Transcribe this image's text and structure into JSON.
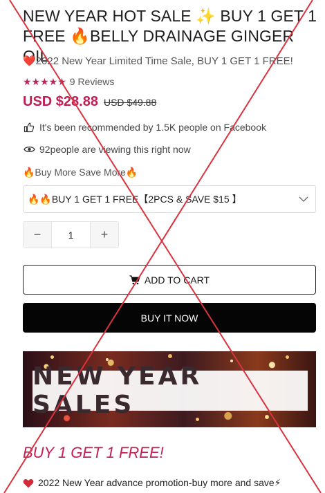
{
  "product": {
    "title": "NEW YEAR HOT SALE ✨ BUY 1 GET 1 FREE 🔥BELLY DRAINAGE GINGER OIL",
    "subtitle": "❤️2022 New Year Limited Time Sale, BUY 1 GET 1 FREE!",
    "stars": "★★★★★",
    "reviews": "9 Reviews",
    "price": "USD $28.88",
    "compare_price": "USD $49.88"
  },
  "social_proof": {
    "recommended": "It's been recommended by 1.5K people on Facebook",
    "viewing": "92people are viewing this right now"
  },
  "buy_more": "🔥Buy More Save More🔥",
  "variant": {
    "selected": "🔥🔥BUY 1 GET 1 FREE【2PCS & SAVE $15 】"
  },
  "quantity": {
    "minus": "−",
    "value": "1",
    "plus": "+"
  },
  "actions": {
    "add_to_cart": "ADD TO CART",
    "buy_now": "BUY IT NOW"
  },
  "banner": {
    "text": "NEW YEAR SALES"
  },
  "promo": {
    "heading": "BUY 1 GET 1 FREE!",
    "line": "2022 New Year advance promotion-buy more and save⚡"
  },
  "colors": {
    "accent": "#c11e54",
    "star": "#b8265d",
    "cross": "#d9333f",
    "button_dark": "#050505"
  }
}
